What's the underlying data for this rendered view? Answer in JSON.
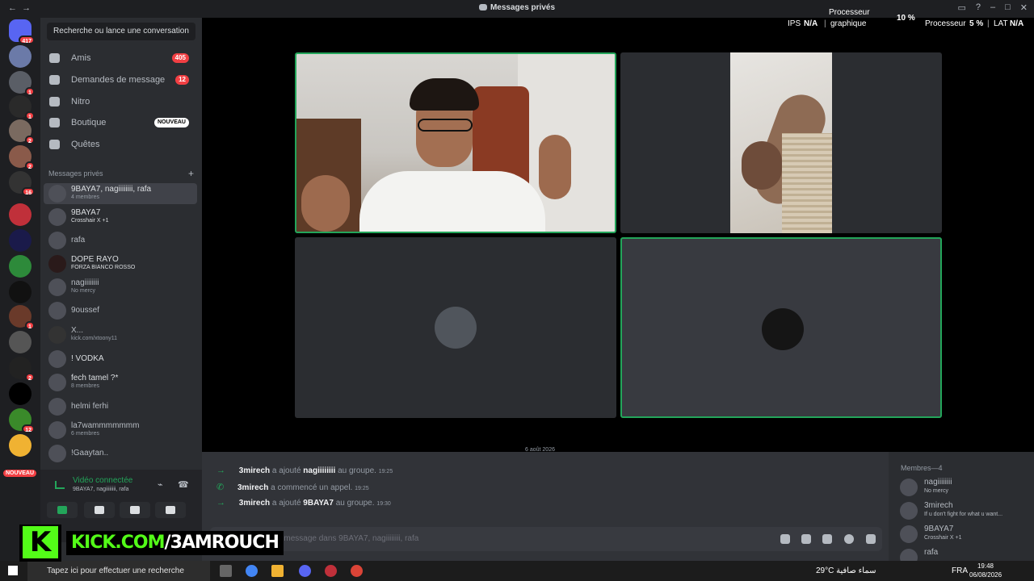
{
  "window": {
    "title": "Messages privés"
  },
  "stats": {
    "ips_label": "IPS",
    "ips_value": "N/A",
    "gpu_label_top": "Processeur",
    "gpu_label_bottom": "graphique",
    "gpu_value": "10 %",
    "cpu_label": "Processeur",
    "cpu_value": "5 %",
    "lat_label": "LAT",
    "lat_value": "N/A"
  },
  "rail": {
    "home_badge": "417",
    "badges": [
      "1",
      "1",
      "2",
      "2",
      "16",
      "1",
      "2",
      "10",
      "12"
    ],
    "new_tag": "NOUVEAU"
  },
  "sidebar": {
    "search_label": "Recherche ou lance une conversation",
    "nav": [
      {
        "label": "Amis",
        "count": "405"
      },
      {
        "label": "Demandes de message",
        "count": "12"
      },
      {
        "label": "Nitro",
        "count": ""
      },
      {
        "label": "Boutique",
        "badge": "NOUVEAU"
      },
      {
        "label": "Quêtes",
        "count": ""
      }
    ],
    "dm_header": "Messages privés",
    "dm_add": "+",
    "dms": [
      {
        "name": "9BAYA7, nagiiiiiiii, rafa",
        "sub": "4 membres"
      },
      {
        "name": "9BAYA7",
        "sub": "Crosshair X +1"
      },
      {
        "name": "rafa",
        "sub": ""
      },
      {
        "name": "DOPE RAYO",
        "sub": "FORZA BIANCO ROSSO"
      },
      {
        "name": "nagiiiiiiii",
        "sub": "No mercy"
      },
      {
        "name": "9oussef",
        "sub": ""
      },
      {
        "name": "X...",
        "sub": "kick.com/xtoony11"
      },
      {
        "name": "! VODKA",
        "sub": ""
      },
      {
        "name": "fech tamel ?*",
        "sub": "8 membres"
      },
      {
        "name": "helmi ferhi",
        "sub": ""
      },
      {
        "name": "la7wammmmmmm",
        "sub": "6 membres"
      },
      {
        "name": "!Gaaytan..",
        "sub": ""
      }
    ]
  },
  "voice": {
    "status": "Vidéo connectée",
    "channel": "9BAYA7, nagiiiiiiii, rafa"
  },
  "kick": {
    "letter": "K",
    "domain": "KICK.COM",
    "handle": "/3AMROUCH"
  },
  "chat": {
    "date": "6 août 2026",
    "messages": [
      {
        "user": "3mirech",
        "text": "a ajouté",
        "target": "nagiiiiiiii",
        "rest": "au groupe.",
        "time": "19:25"
      },
      {
        "user": "3mirech",
        "text": "a commencé un appel.",
        "target": "",
        "rest": "",
        "time": "19:25"
      },
      {
        "user": "3mirech",
        "text": "a ajouté",
        "target": "9BAYA7",
        "rest": "au groupe.",
        "time": "19:30"
      }
    ],
    "placeholder": "Envoyer un message dans 9BAYA7, nagiiiiiiii, rafa"
  },
  "members": {
    "header": "Membres—4",
    "list": [
      {
        "name": "nagiiiiiiii",
        "status": "No mercy"
      },
      {
        "name": "3mirech",
        "status": "If u don't fight for what u want..."
      },
      {
        "name": "9BAYA7",
        "status": "Crosshair X +1"
      },
      {
        "name": "rafa",
        "status": ""
      }
    ]
  },
  "taskbar": {
    "search_placeholder": "Tapez ici pour effectuer une recherche",
    "weather": "29°C سماء صافية",
    "lang": "FRA",
    "time": "19:48",
    "date": "06/08/2026"
  }
}
